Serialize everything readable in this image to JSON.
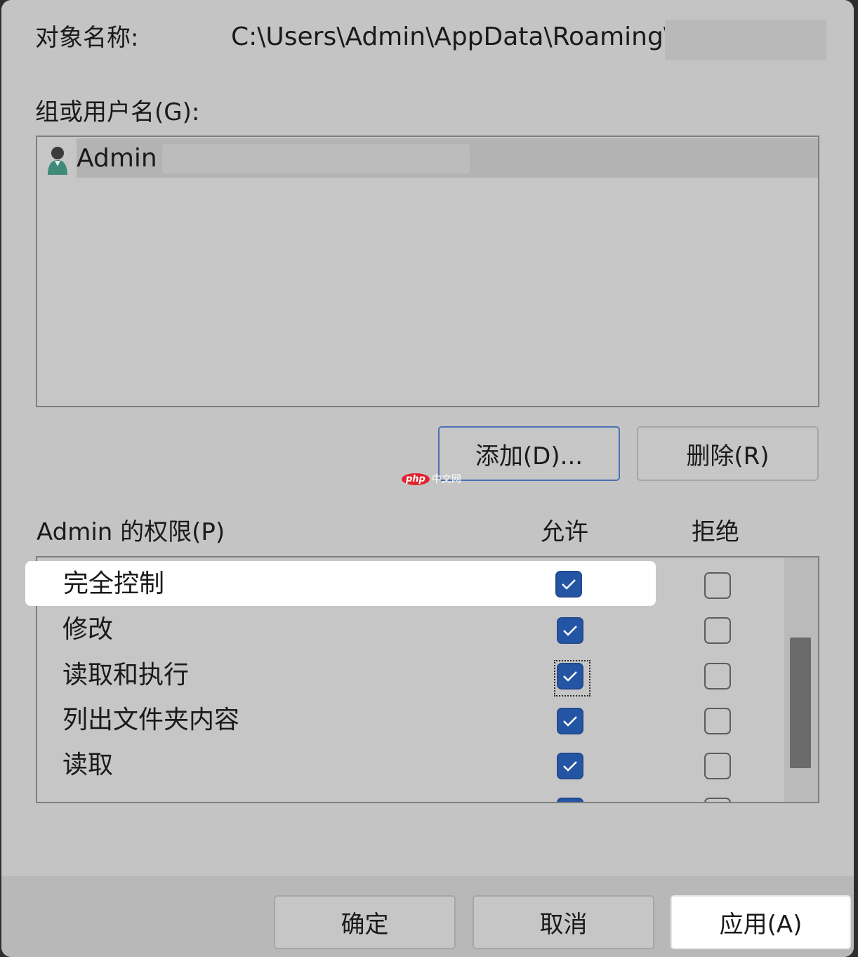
{
  "object": {
    "label": "对象名称:",
    "path": "C:\\Users\\Admin\\AppData\\Roaming\\"
  },
  "groups": {
    "label": "组或用户名(G):",
    "users": [
      {
        "name": "Admin",
        "icon": "user-icon"
      }
    ],
    "add_button": "添加(D)...",
    "remove_button": "删除(R)"
  },
  "watermark": {
    "logo": "php",
    "text": "中文网"
  },
  "permissions": {
    "label": "Admin 的权限(P)",
    "allow_header": "允许",
    "deny_header": "拒绝",
    "rows": [
      {
        "name": "完全控制",
        "allow": true,
        "deny": false
      },
      {
        "name": "修改",
        "allow": true,
        "deny": false
      },
      {
        "name": "读取和执行",
        "allow": true,
        "deny": false
      },
      {
        "name": "列出文件夹内容",
        "allow": true,
        "deny": false
      },
      {
        "name": "读取",
        "allow": true,
        "deny": false
      }
    ]
  },
  "footer": {
    "ok": "确定",
    "cancel": "取消",
    "apply": "应用(A)"
  },
  "colors": {
    "accent": "#2454a4",
    "dialog_bg": "#c4c4c4",
    "highlight": "#ffffff"
  }
}
